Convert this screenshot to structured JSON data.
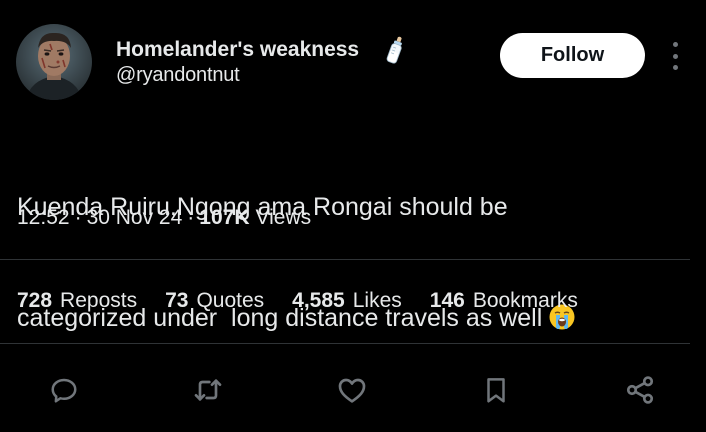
{
  "author": {
    "display_name": "Homelander's weakness",
    "handle": "@ryandontnut",
    "name_emoji": "baby-bottle-icon"
  },
  "follow_button_label": "Follow",
  "tweet": {
    "text_line_1": "Kuenda Ruiru,Ngong ama Rongai should be",
    "text_line_2": "categorized under  long distance travels as well",
    "trailing_emoji": "loudly-crying-face-icon"
  },
  "meta": {
    "time": "12:52",
    "separator": "·",
    "date": "30 Nov 24",
    "views_count": "107K",
    "views_label": "Views"
  },
  "stats": {
    "reposts": {
      "count": "728",
      "label": "Reposts"
    },
    "quotes": {
      "count": "73",
      "label": "Quotes"
    },
    "likes": {
      "count": "4,585",
      "label": "Likes"
    },
    "bookmarks": {
      "count": "146",
      "label": "Bookmarks"
    }
  },
  "actions": [
    "reply-icon",
    "repost-icon",
    "like-icon",
    "bookmark-icon",
    "share-icon"
  ],
  "colors": {
    "background": "#000000",
    "text": "#e7e9ea",
    "icon": "#71767b",
    "divider": "#2f3336",
    "button_bg": "#ffffff",
    "button_text": "#0f1419"
  }
}
